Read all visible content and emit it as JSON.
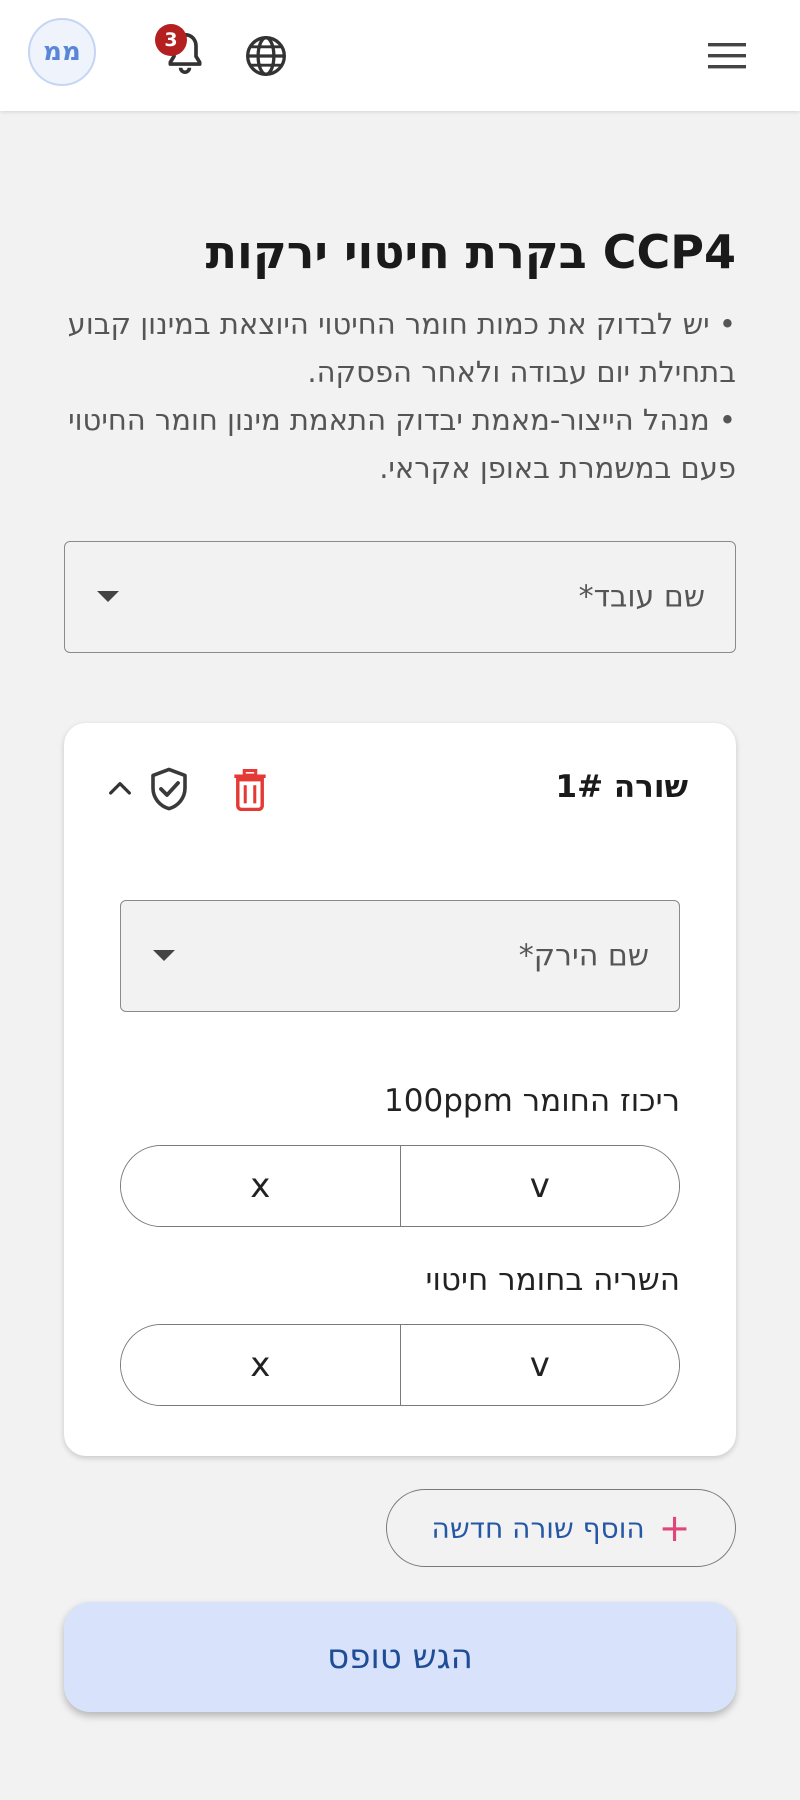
{
  "header": {
    "avatar_initials": "ממ",
    "notification_count": "3",
    "icons": [
      "bell-icon",
      "globe-icon",
      "menu-icon"
    ]
  },
  "page": {
    "title": "CCP4 בקרת חיטוי ירקות",
    "instructions": [
      "• יש לבדוק את כמות חומר החיטוי היוצאת במינון קבוע בתחילת יום עבודה ולאחר הפסקה.",
      "• מנהל הייצור-מאמת יבדוק התאמת מינון חומר החיטוי פעם במשמרת באופן אקראי."
    ]
  },
  "employee_select": {
    "label": "שם עובד*"
  },
  "row_card": {
    "title": "שורה 1#",
    "icons": [
      "trash-icon",
      "shield-check-icon",
      "chevron-up-icon"
    ],
    "plant_select": {
      "label": "שם הירק*"
    },
    "questions": [
      {
        "label": "ריכוז החומר 100ppm",
        "yes": "v",
        "no": "x"
      },
      {
        "label": "השריה בחומר חיטוי",
        "yes": "v",
        "no": "x"
      }
    ]
  },
  "actions": {
    "add_row_label": "הוסף שורה חדשה",
    "add_row_icon": "+",
    "submit_label": "הגש טופס"
  },
  "colors": {
    "accent_blue": "#2557a7",
    "delete_red": "#e53935",
    "plus_pink": "#e0467a",
    "submit_bg": "#d8e3fb",
    "badge_red": "#b3201f"
  }
}
